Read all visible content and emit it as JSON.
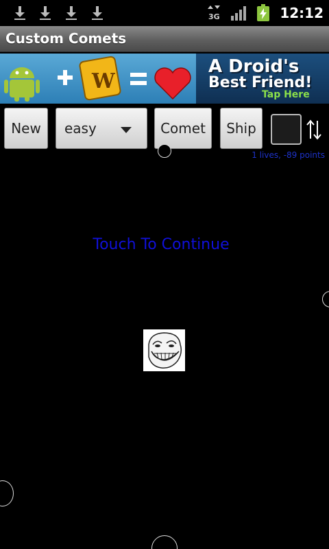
{
  "status_bar": {
    "time": "12:12",
    "network": "3G",
    "notification_icons": [
      "download-icon",
      "download-icon",
      "download-icon",
      "download-icon"
    ],
    "right_icons": [
      "network-3g-icon",
      "signal-icon",
      "battery-charging-icon"
    ]
  },
  "app": {
    "title": "Custom Comets"
  },
  "ad": {
    "headline": "A Droid's",
    "subline": "Best Friend!",
    "cta": "Tap Here",
    "icons": [
      "android-robot-icon",
      "plus-icon",
      "words-tile-icon",
      "equals-icon",
      "heart-icon"
    ]
  },
  "controls": {
    "new_label": "New",
    "difficulty": "easy",
    "comet_label": "Comet",
    "ship_label": "Ship",
    "checkbox_checked": false
  },
  "score_text": "1 lives, -89 points",
  "game": {
    "message": "Touch To Continue",
    "ship_icon": "troll-face-icon"
  },
  "colors": {
    "background": "#000000",
    "message": "#1010d8",
    "score": "#1e33cc",
    "battery": "#8dc63f"
  }
}
